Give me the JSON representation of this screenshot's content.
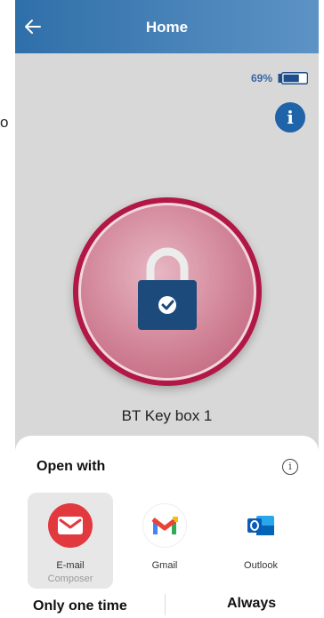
{
  "edge": {
    "glyph": "o"
  },
  "header": {
    "title": "Home",
    "back_icon": "arrow-left-icon"
  },
  "status": {
    "battery_percent": "69%",
    "battery_level": 0.69
  },
  "lock": {
    "device_name": "BT Key box 1",
    "icon": "padlock-check-icon"
  },
  "sheet": {
    "title": "Open with",
    "apps": [
      {
        "label": "E-mail",
        "sublabel": "Composer",
        "icon": "envelope-icon",
        "selected": true
      },
      {
        "label": "Gmail",
        "icon": "gmail-icon"
      },
      {
        "label": "Outlook",
        "icon": "outlook-icon"
      }
    ],
    "buttons": {
      "once": "Only one time",
      "always": "Always"
    }
  },
  "colors": {
    "header_start": "#2f6fa9",
    "header_end": "#5d93c5",
    "ring": "#b11845",
    "lock_body": "#1c4a7a",
    "info": "#1f63a8"
  }
}
